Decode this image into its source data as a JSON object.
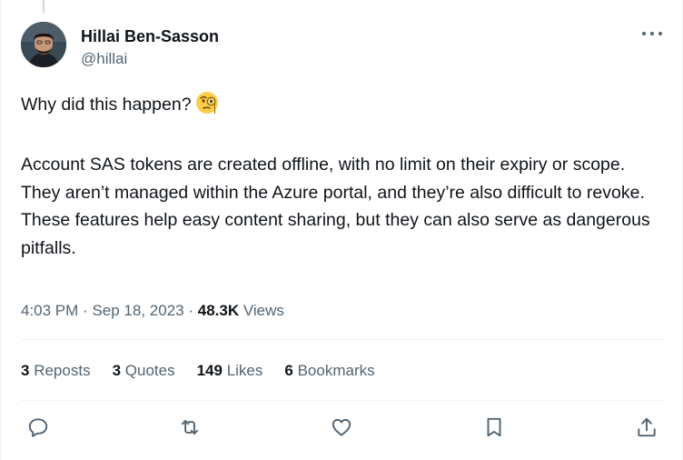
{
  "author": {
    "name": "Hillai Ben-Sasson",
    "handle": "@hillai"
  },
  "tweet": {
    "line1": "Why did this happen?",
    "emoji": "face-with-monocle",
    "paragraph2": "Account SAS tokens are created offline, with no limit on their expiry or scope. They aren’t managed within the Azure portal, and they’re also difficult to revoke.\nThese features help easy content sharing, but they can also serve as dangerous pitfalls."
  },
  "meta": {
    "time": "4:03 PM",
    "sep1": "·",
    "date": "Sep 18, 2023",
    "sep2": "·",
    "views_count": "48.3K",
    "views_label": "Views"
  },
  "stats": {
    "reposts_count": "3",
    "reposts_label": "Reposts",
    "quotes_count": "3",
    "quotes_label": "Quotes",
    "likes_count": "149",
    "likes_label": "Likes",
    "bookmarks_count": "6",
    "bookmarks_label": "Bookmarks"
  },
  "actions": {
    "icons": [
      "reply-icon",
      "repost-icon",
      "like-icon",
      "bookmark-icon",
      "share-icon"
    ]
  },
  "colors": {
    "text": "#0f1419",
    "secondary": "#536471",
    "divider": "#eff3f4"
  }
}
